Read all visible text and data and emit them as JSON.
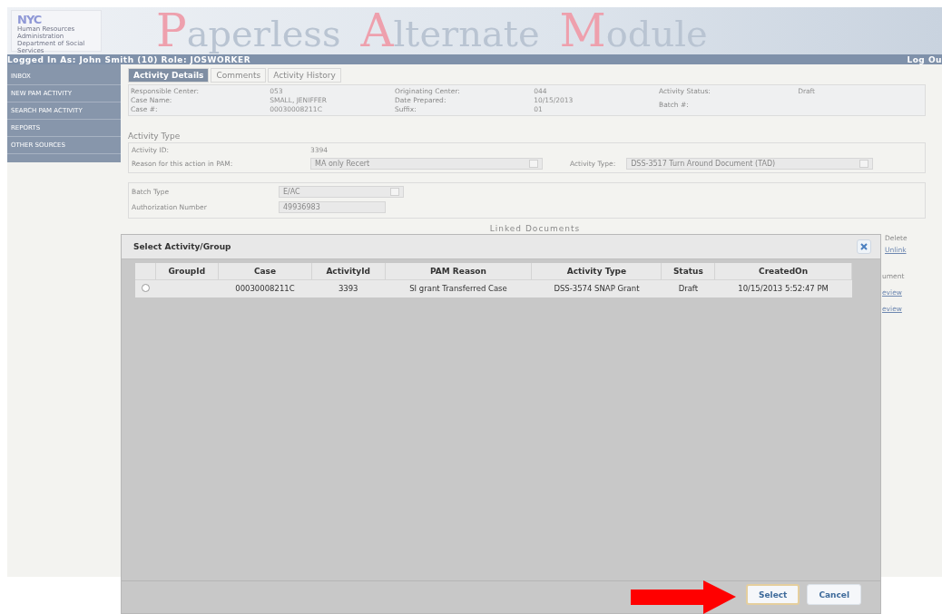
{
  "header": {
    "logo": "NYC",
    "agency": "Human Resources Administration Department of Social Services",
    "title": "Paperless Alternate Module"
  },
  "user_bar": {
    "text": "Logged In As: John Smith (10) Role: JOSWORKER",
    "logout": "Log Ou"
  },
  "sidebar": {
    "items": [
      {
        "label": "INBOX",
        "selected": false
      },
      {
        "label": "NEW PAM ACTIVITY",
        "selected": false
      },
      {
        "label": "SEARCH PAM ACTIVITY",
        "selected": false
      },
      {
        "label": "REPORTS",
        "selected": false
      },
      {
        "label": "OTHER SOURCES",
        "selected": false
      }
    ]
  },
  "tabs": [
    {
      "label": "Activity Details",
      "selected": true
    },
    {
      "label": "Comments",
      "selected": false
    },
    {
      "label": "Activity History",
      "selected": false
    }
  ],
  "details": [
    [
      {
        "label": "Responsible Center:",
        "value": "053"
      },
      {
        "label": "Case Name:",
        "value": "SMALL, JENIFFER"
      },
      {
        "label": "Case #:",
        "value": "00030008211C"
      }
    ],
    [
      {
        "label": "Originating Center:",
        "value": "044"
      },
      {
        "label": "Date Prepared:",
        "value": "10/15/2013"
      },
      {
        "label": "Suffix:",
        "value": "01"
      }
    ],
    [
      {
        "label": "Activity Status:",
        "value": "Draft"
      },
      {
        "label": "Batch #:"
      }
    ]
  ],
  "activity_type": {
    "heading": "Activity Type",
    "id_label": "Activity ID:",
    "id_value": "3394",
    "reason_label": "Reason for this action in PAM:",
    "reason_value": "MA only Recert",
    "type_label": "Activity Type:",
    "type_value": "DSS-3517 Turn Around Document (TAD)"
  },
  "batch": {
    "type_label": "Batch Type",
    "type_value": "E/AC",
    "auth_label": "Authorization Number",
    "auth_value": "49936983"
  },
  "linked_documents": {
    "heading": "Linked Documents",
    "delete": "Delete",
    "unlink": "Unlink",
    "document": "ument",
    "previews": [
      "eview",
      "eview"
    ]
  },
  "dialog": {
    "title": "Select Activity/Group",
    "columns": [
      "GroupId",
      "Case",
      "ActivityId",
      "PAM Reason",
      "Activity Type",
      "Status",
      "CreatedOn"
    ],
    "rows": [
      {
        "selected": false,
        "cells": [
          "",
          "00030008211C",
          "3393",
          "SI grant Transferred Case",
          "DSS-3574 SNAP Grant",
          "Draft",
          "10/15/2013 5:52:47 PM"
        ]
      }
    ],
    "buttons": [
      {
        "label": "Select",
        "kind": "primary"
      },
      {
        "label": "Cancel",
        "kind": "secondary"
      }
    ]
  }
}
